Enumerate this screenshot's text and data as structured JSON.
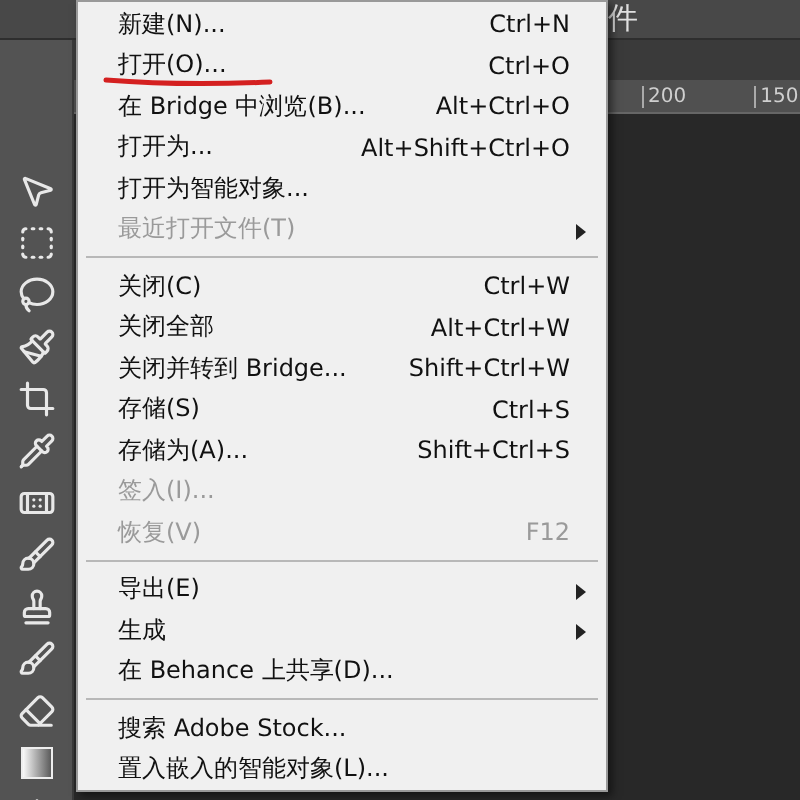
{
  "options_bar": {
    "label": "件"
  },
  "ruler": {
    "ticks": [
      "200",
      "150"
    ]
  },
  "file_menu": {
    "items": [
      {
        "kind": "item",
        "label": "新建(N)...",
        "shortcut": "Ctrl+N",
        "disabled": false,
        "submenu": false,
        "underlined": false
      },
      {
        "kind": "item",
        "label": "打开(O)...",
        "shortcut": "Ctrl+O",
        "disabled": false,
        "submenu": false,
        "underlined": true
      },
      {
        "kind": "item",
        "label": "在 Bridge 中浏览(B)...",
        "shortcut": "Alt+Ctrl+O",
        "disabled": false,
        "submenu": false,
        "underlined": false
      },
      {
        "kind": "item",
        "label": "打开为...",
        "shortcut": "Alt+Shift+Ctrl+O",
        "disabled": false,
        "submenu": false,
        "underlined": false
      },
      {
        "kind": "item",
        "label": "打开为智能对象...",
        "disabled": false,
        "submenu": false,
        "underlined": false
      },
      {
        "kind": "item",
        "label": "最近打开文件(T)",
        "disabled": true,
        "submenu": true,
        "underlined": false
      },
      {
        "kind": "separator"
      },
      {
        "kind": "item",
        "label": "关闭(C)",
        "shortcut": "Ctrl+W",
        "disabled": false,
        "submenu": false,
        "underlined": false
      },
      {
        "kind": "item",
        "label": "关闭全部",
        "shortcut": "Alt+Ctrl+W",
        "disabled": false,
        "submenu": false,
        "underlined": false
      },
      {
        "kind": "item",
        "label": "关闭并转到 Bridge...",
        "shortcut": "Shift+Ctrl+W",
        "disabled": false,
        "submenu": false,
        "underlined": false
      },
      {
        "kind": "item",
        "label": "存储(S)",
        "shortcut": "Ctrl+S",
        "disabled": false,
        "submenu": false,
        "underlined": false
      },
      {
        "kind": "item",
        "label": "存储为(A)...",
        "shortcut": "Shift+Ctrl+S",
        "disabled": false,
        "submenu": false,
        "underlined": false
      },
      {
        "kind": "item",
        "label": "签入(I)...",
        "disabled": true,
        "submenu": false,
        "underlined": false
      },
      {
        "kind": "item",
        "label": "恢复(V)",
        "shortcut": "F12",
        "disabled": true,
        "submenu": false,
        "underlined": false
      },
      {
        "kind": "separator"
      },
      {
        "kind": "item",
        "label": "导出(E)",
        "disabled": false,
        "submenu": true,
        "underlined": false
      },
      {
        "kind": "item",
        "label": "生成",
        "disabled": false,
        "submenu": true,
        "underlined": false
      },
      {
        "kind": "item",
        "label": "在 Behance 上共享(D)...",
        "disabled": false,
        "submenu": false,
        "underlined": false
      },
      {
        "kind": "separator"
      },
      {
        "kind": "item",
        "label": "搜索 Adobe Stock...",
        "disabled": false,
        "submenu": false,
        "underlined": false
      },
      {
        "kind": "item",
        "label": "置入嵌入的智能对象(L)...",
        "disabled": false,
        "submenu": false,
        "underlined": false
      }
    ]
  }
}
